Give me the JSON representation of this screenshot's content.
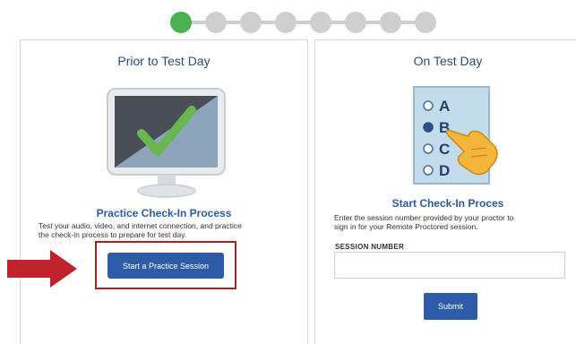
{
  "stepper": {
    "total_steps": 8,
    "current_step": 1,
    "active_color": "#4caf50"
  },
  "left_panel": {
    "title": "Prior to Test Day",
    "heading": "Practice Check-In Process",
    "description_line1": "Test your audio, video, and internet connection, and practice",
    "description_line2": "the check-in process to prepare for test day.",
    "button_label": "Start a Practice Session"
  },
  "right_panel": {
    "title": "On Test Day",
    "options": [
      "A",
      "B",
      "C",
      "D"
    ],
    "selected_option": "B",
    "heading": "Start Check-In Proces",
    "description_line1": "Enter the session number provided by your proctor to",
    "description_line2": "sign in for your Remote Proctored session.",
    "field_label": "SESSION NUMBER",
    "field_value": "",
    "submit_label": "Submit"
  },
  "colors": {
    "primary_button": "#2e5ba8",
    "highlight": "#b22025",
    "heading": "#2b5aa6"
  }
}
